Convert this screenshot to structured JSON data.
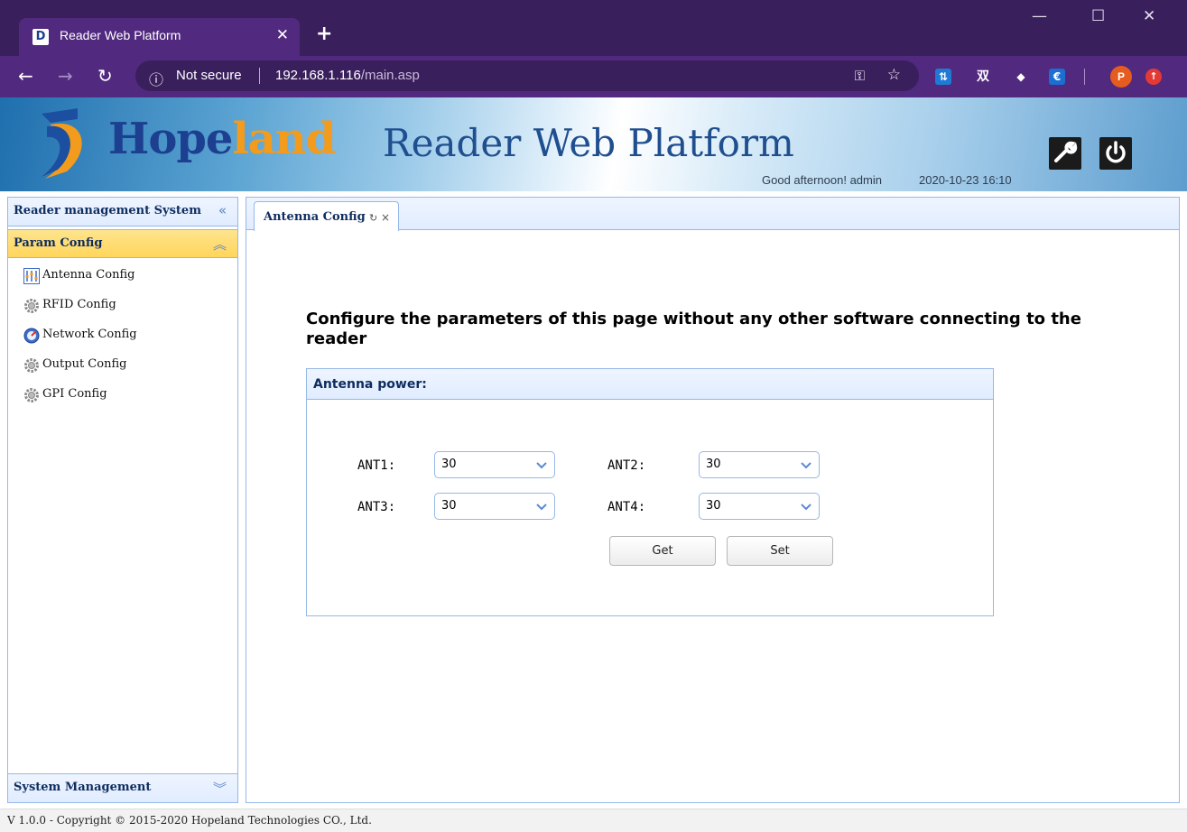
{
  "browser": {
    "tab_title": "Reader Web Platform",
    "tab_favicon": "D",
    "tab_close": "✕",
    "new_tab": "+",
    "security_label": "Not secure",
    "url_host": "192.168.1.116",
    "url_path": "/main.asp",
    "extensions": [
      "translate-ext-icon",
      "双",
      "box-ext-icon",
      "€"
    ],
    "profile_initial": "P",
    "window_controls": [
      "—",
      "☐",
      "✕"
    ]
  },
  "header": {
    "brand_main": "Hope",
    "brand_accent": "land",
    "app_title": "Reader Web Platform",
    "greeting": "Good afternoon! admin",
    "datetime": "2020-10-23 16:10"
  },
  "sidebar": {
    "title": "Reader management System",
    "group_label": "Param Config",
    "items": [
      {
        "label": "Antenna Config",
        "icon": "antenna-icon"
      },
      {
        "label": "RFID Config",
        "icon": "gear-icon"
      },
      {
        "label": "Network Config",
        "icon": "network-icon"
      },
      {
        "label": "Output Config",
        "icon": "gear-icon"
      },
      {
        "label": "GPI Config",
        "icon": "gear-icon"
      }
    ],
    "bottom_group_label": "System Management"
  },
  "main": {
    "tab_label": "Antenna Config",
    "heading": "Configure the parameters of this page without any other software connecting to the reader",
    "panel_title": "Antenna power:",
    "antennas": [
      {
        "label": "ANT1:",
        "value": "30"
      },
      {
        "label": "ANT2:",
        "value": "30"
      },
      {
        "label": "ANT3:",
        "value": "30"
      },
      {
        "label": "ANT4:",
        "value": "30"
      }
    ],
    "get_label": "Get",
    "set_label": "Set"
  },
  "footer": {
    "text": "V 1.0.0 - Copyright © 2015-2020 Hopeland Technologies CO., Ltd."
  },
  "colors": {
    "chrome_dark": "#3a1f5d",
    "chrome_toolbar": "#512a7f",
    "brand_blue": "#1d3f8f",
    "brand_orange": "#f29b1d",
    "panel_border": "#95b8e7",
    "active_group": "#ffd65c"
  }
}
